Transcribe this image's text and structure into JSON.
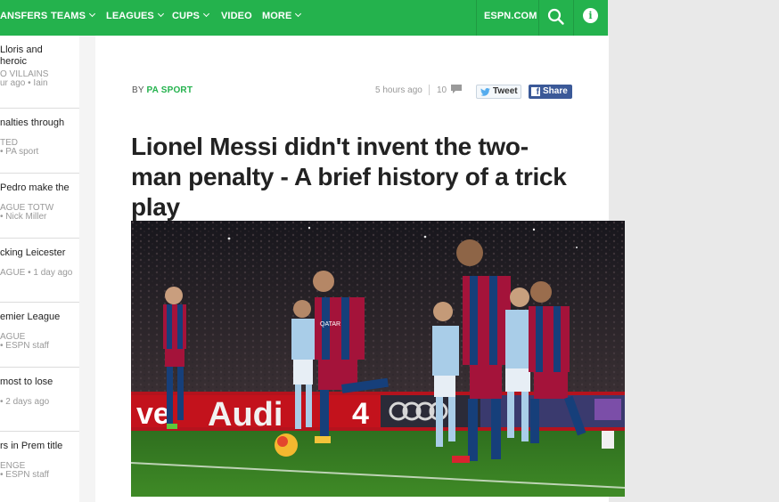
{
  "nav": {
    "items": [
      {
        "label": "ANSFERS",
        "caret": false
      },
      {
        "label": "TEAMS",
        "caret": true
      },
      {
        "label": "LEAGUES",
        "caret": true
      },
      {
        "label": "CUPS",
        "caret": true
      },
      {
        "label": "VIDEO",
        "caret": false
      },
      {
        "label": "MORE",
        "caret": true
      }
    ],
    "espn_label": "ESPN.COM",
    "search_icon": "search-icon",
    "info_icon": "info-icon",
    "info_glyph": "i",
    "accent_color": "#24b24d"
  },
  "sidebar": {
    "items": [
      {
        "title_lines": [
          "Lloris and",
          "heroic"
        ],
        "meta_lines": [
          "O VILLAINS",
          "ur ago • Iain"
        ]
      },
      {
        "title_lines": [
          "nalties through"
        ],
        "meta_lines": [
          "TED",
          "• PA sport"
        ]
      },
      {
        "title_lines": [
          "Pedro make the"
        ],
        "meta_lines": [
          "AGUE TOTW",
          "• Nick Miller"
        ]
      },
      {
        "title_lines": [
          "cking Leicester"
        ],
        "meta_lines": [
          "AGUE • 1 day ago"
        ]
      },
      {
        "title_lines": [
          "emier League"
        ],
        "meta_lines": [
          "AGUE",
          "• ESPN staff"
        ]
      },
      {
        "title_lines": [
          "most to lose"
        ],
        "meta_lines": [
          "• 2 days ago"
        ]
      },
      {
        "title_lines": [
          "rs in Prem title"
        ],
        "meta_lines": [
          "ENGE",
          "• ESPN staff"
        ]
      }
    ]
  },
  "article": {
    "by": "BY",
    "source": "PA SPORT",
    "timestamp": "5 hours ago",
    "comment_count": "10",
    "tweet_label": "Tweet",
    "share_label": "Share",
    "headline": "Lionel Messi didn't invent the two-man penalty - A brief history of a trick play",
    "hero_image": {
      "alt_icon": "football-match-photo",
      "board_text_1": "ve",
      "board_text_2": "Audi",
      "board_text_3": "4",
      "board_text_4": "Audi",
      "shirt_text": "QATAR"
    }
  }
}
